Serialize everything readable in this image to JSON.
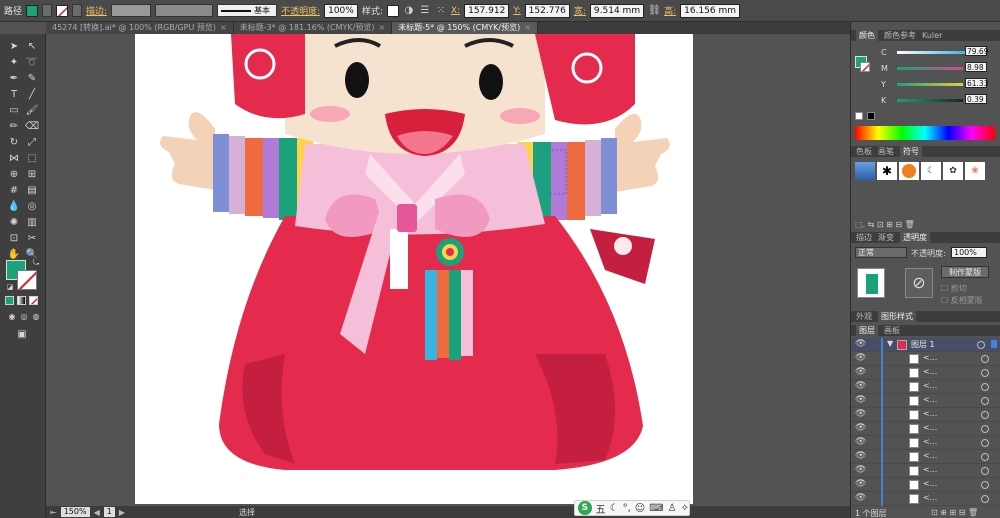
{
  "control_bar": {
    "object_type": "路径",
    "fill_color": "#1aa37a",
    "stroke_label": "描边:",
    "brush_label": "基本",
    "opacity_label": "不透明度:",
    "opacity_value": "100%",
    "style_label": "样式:",
    "x_label": "X:",
    "x_value": "157.912",
    "y_label": "Y:",
    "y_value": "152.776",
    "w_label": "宽:",
    "w_value": "9.514 mm",
    "h_label": "高:",
    "h_value": "16.156 mm"
  },
  "tabs": [
    {
      "label": "45274 [转换].ai* @ 100% (RGB/GPU 预览)",
      "active": false
    },
    {
      "label": "未标题-3* @ 181.16% (CMYK/预览)",
      "active": false
    },
    {
      "label": "未标题-5* @ 150% (CMYK/预览)",
      "active": true
    }
  ],
  "statusbar": {
    "zoom": "150%",
    "page": "1",
    "tool": "选择"
  },
  "ime": {
    "logo": "S",
    "mode": "五"
  },
  "tools": {
    "fill_color": "#1aa37a"
  },
  "panels": {
    "color": {
      "tabs": [
        "颜色",
        "颜色参考",
        "Kuler"
      ],
      "active_tab": "颜色",
      "channels": [
        {
          "name": "C",
          "value": "79.69",
          "color": "#1aa37a"
        },
        {
          "name": "M",
          "value": "8.98",
          "color": "#d14a8a"
        },
        {
          "name": "Y",
          "value": "61.33",
          "color": "#e0d040"
        },
        {
          "name": "K",
          "value": "0.39",
          "color": "#222222"
        }
      ]
    },
    "swatches": {
      "tabs": [
        "色板",
        "画笔",
        "符号"
      ],
      "active_tab": "符号"
    },
    "transparency": {
      "tabs": [
        "描边",
        "渐变",
        "透明度"
      ],
      "active_tab": "透明度",
      "blend_mode": "正常",
      "opacity_label": "不透明度:",
      "opacity_value": "100%",
      "make_mask": "制作蒙版",
      "clip_label": "剪切",
      "invert_label": "反相蒙版"
    },
    "appearance": {
      "tabs": [
        "外观",
        "图形样式"
      ],
      "active_tab": "图形样式"
    },
    "layers": {
      "tabs": [
        "图层",
        "画板"
      ],
      "active_tab": "图层",
      "top_layer_name": "图层 1",
      "sub_item_label": "<...",
      "footer": "1 个图层"
    }
  }
}
